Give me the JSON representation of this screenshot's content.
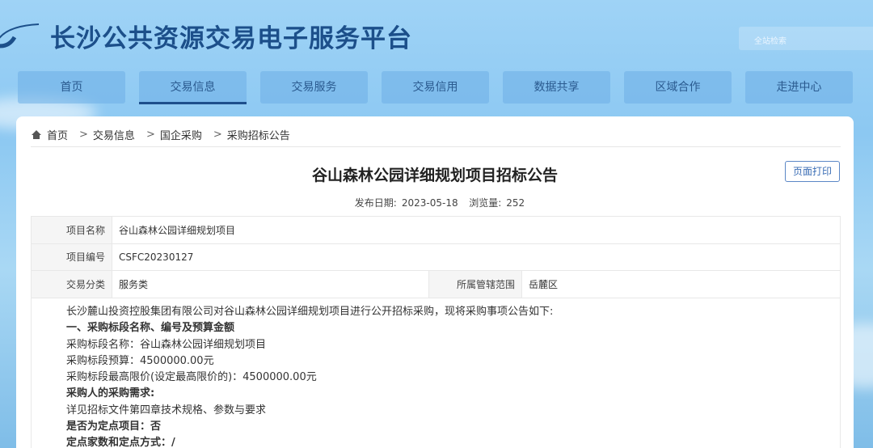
{
  "header": {
    "site_title": "长沙公共资源交易电子服务平台",
    "search_placeholder": "全站检索"
  },
  "nav": [
    {
      "label": "首页"
    },
    {
      "label": "交易信息",
      "active": true
    },
    {
      "label": "交易服务"
    },
    {
      "label": "交易信用"
    },
    {
      "label": "数据共享"
    },
    {
      "label": "区域合作"
    },
    {
      "label": "走进中心"
    }
  ],
  "breadcrumb": [
    "首页",
    "交易信息",
    "国企采购",
    "采购招标公告"
  ],
  "article": {
    "title": "谷山森林公园详细规划项目招标公告",
    "print_label": "页面打印",
    "date_label": "发布日期:",
    "date": "2023-05-18",
    "views_label": "浏览量:",
    "views": "252"
  },
  "info": {
    "name_label": "项目名称",
    "name": "谷山森林公园详细规划项目",
    "code_label": "项目编号",
    "code": "CSFC20230127",
    "category_label": "交易分类",
    "category": "服务类",
    "region_label": "所属管辖范围",
    "region": "岳麓区"
  },
  "content": [
    {
      "text": "长沙麓山投资控股集团有限公司对谷山森林公园详细规划项目进行公开招标采购，现将采购事项公告如下:",
      "bold": false
    },
    {
      "text": "一、采购标段名称、编号及预算金额",
      "bold": true
    },
    {
      "text": "采购标段名称：谷山森林公园详细规划项目",
      "bold": false
    },
    {
      "text": "采购标段预算：4500000.00元",
      "bold": false
    },
    {
      "text": "采购标段最高限价(设定最高限价的)：4500000.00元",
      "bold": false
    },
    {
      "text": "采购人的采购需求:",
      "bold": true
    },
    {
      "text": "详见招标文件第四章技术规格、参数与要求",
      "bold": false
    },
    {
      "text": "是否为定点项目：否",
      "bold": true
    },
    {
      "text": "定点家数和定点方式：/",
      "bold": true
    }
  ]
}
